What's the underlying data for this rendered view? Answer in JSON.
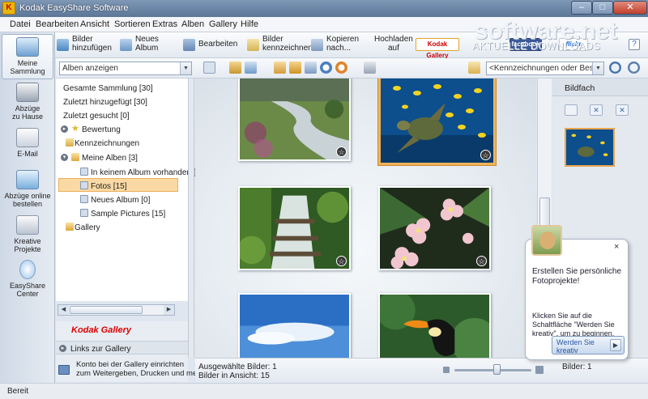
{
  "window": {
    "title": "Kodak EasyShare Software",
    "minimize_glyph": "–",
    "maximize_glyph": "□",
    "close_glyph": "✕"
  },
  "menu": [
    "Datei",
    "Bearbeiten",
    "Ansicht",
    "Sortieren",
    "Extras",
    "Alben",
    "Gallery",
    "Hilfe"
  ],
  "toolbar": {
    "add_pictures": "Bilder\nhinzufügen",
    "new_album": "Neues\nAlbum",
    "edit": "Bearbeiten",
    "tag_pictures": "Bilder\nkennzeichnen",
    "copy_to": "Kopieren\nnach...",
    "upload_to": "Hochladen\nauf",
    "kodak_gallery": "Kodak Gallery",
    "facebook": "facebook",
    "flickr": "flickr",
    "help": "?"
  },
  "watermark": {
    "brand": "software.net",
    "tagline": "AKTUELLE DOWNLOADS"
  },
  "left_nav": [
    {
      "label": "Meine\nSammlung",
      "icon": "collection-icon"
    },
    {
      "label": "Abzüge\nzu Hause",
      "icon": "printer-icon"
    },
    {
      "label": "E-Mail",
      "icon": "email-icon"
    },
    {
      "label": "Abzüge online\nbestellen",
      "icon": "order-prints-icon"
    },
    {
      "label": "Kreative\nProjekte",
      "icon": "creative-projects-icon"
    },
    {
      "label": "EasyShare\nCenter",
      "icon": "easyshare-center-icon"
    }
  ],
  "filter": {
    "view_select": "Alben anzeigen",
    "search_placeholder": "<Kennzeichnungen oder Besch"
  },
  "tree": {
    "all_collection": "Gesamte Sammlung [30]",
    "recently_added": "Zuletzt hinzugefügt [30]",
    "recently_searched": "Zuletzt gesucht [0]",
    "rating": "Bewertung",
    "tags": "Kennzeichnungen",
    "my_albums": "Meine Alben [3]",
    "albums": [
      "In keinem Album vorhanden [",
      "Fotos [15]",
      "Neues Album [0]",
      "Sample Pictures [15]"
    ],
    "gallery": "Gallery"
  },
  "gallery_panel": {
    "logo": "Kodak Gallery",
    "links": "Links zur Gallery",
    "account_text": "Konto bei der Gallery einrichten\nzum Weitergeben, Drucken und mehr"
  },
  "photos": [
    {
      "name": "mountain-stream",
      "rating_icon": "☆"
    },
    {
      "name": "sea-turtle",
      "rating_icon": "☆",
      "selected": true
    },
    {
      "name": "waterfall",
      "rating_icon": "☆"
    },
    {
      "name": "plumeria-flowers",
      "rating_icon": "☆"
    },
    {
      "name": "sky-clouds"
    },
    {
      "name": "toucan"
    }
  ],
  "status": {
    "selected": "Ausgewählte Bilder: 1",
    "in_view": "Bilder in Ansicht: 15",
    "ready": "Bereit"
  },
  "bildfach": {
    "title": "Bildfach",
    "count_label": "Bilder:",
    "count": "1"
  },
  "popup": {
    "close": "×",
    "heading": "Erstellen Sie persönliche\nFotoprojekte!",
    "body": "Klicken Sie auf die\nSchaltfläche \"Werden Sie\nkreativ\", um zu beginnen.",
    "button": "Werden Sie\nkreativ",
    "button_arrow": "▶"
  },
  "colors": {
    "accent_orange": "#f0b35a",
    "kodak_red": "#d00000",
    "titlebar": "#6b86a6"
  }
}
